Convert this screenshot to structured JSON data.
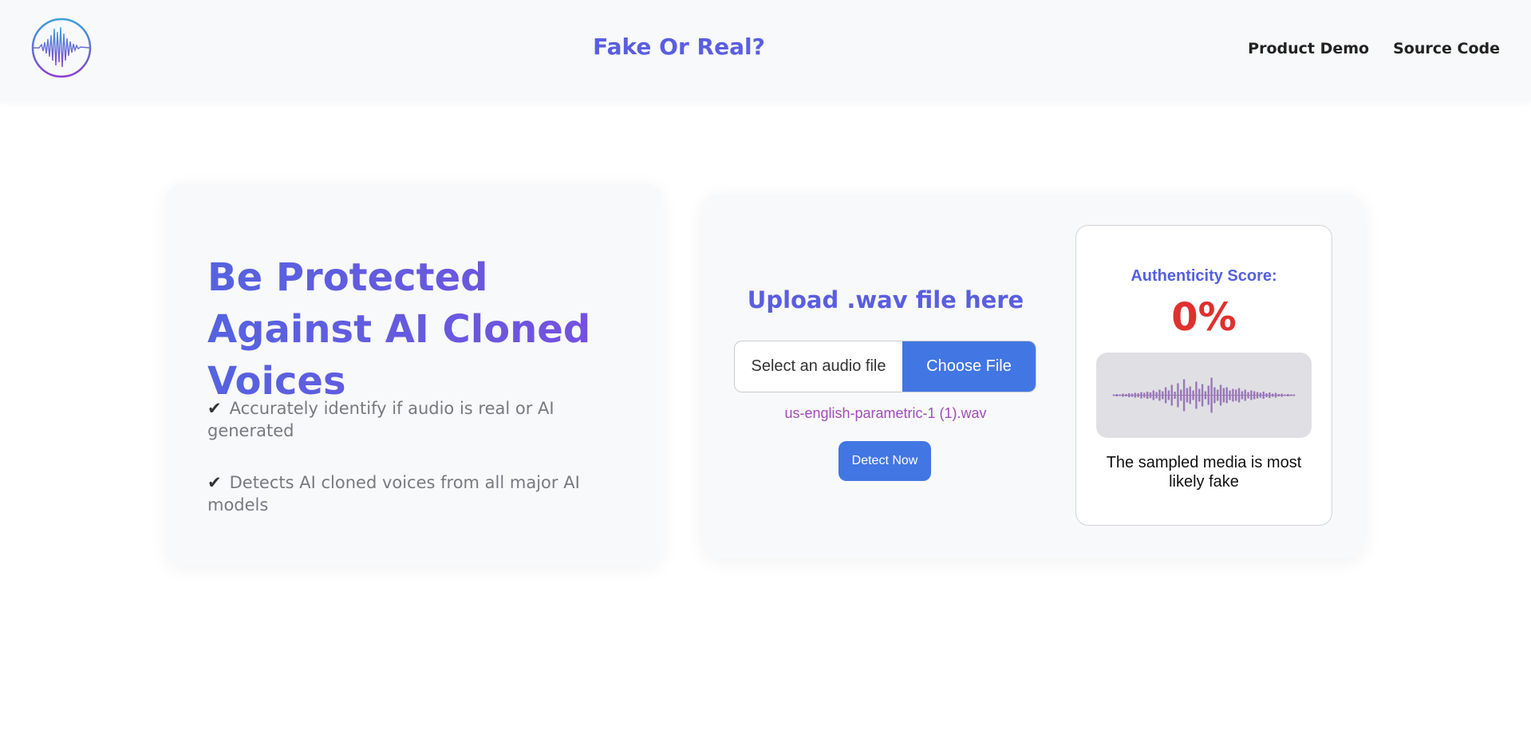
{
  "header": {
    "title": "Fake Or Real?",
    "logo_icon": "waveform-logo-icon",
    "nav": [
      {
        "label": "Product Demo"
      },
      {
        "label": "Source Code"
      }
    ]
  },
  "hero": {
    "title": "Be Protected Against AI Cloned Voices",
    "features": [
      {
        "check": "✔",
        "text": "Accurately identify if audio is real or AI generated"
      },
      {
        "check": "✔",
        "text": "Detects AI cloned voices from all major AI models"
      }
    ]
  },
  "upload": {
    "title": "Upload .wav file here",
    "placeholder": "Select an audio file",
    "choose_label": "Choose File",
    "file_name": "us-english-parametric-1 (1).wav",
    "detect_label": "Detect Now"
  },
  "result": {
    "score_label": "Authenticity Score:",
    "score_value": "0%",
    "waveform_icon": "audio-waveform-icon",
    "verdict": "The sampled media is most likely fake"
  },
  "colors": {
    "accent": "#5a5ee0",
    "button": "#4276e3",
    "score": "#e0302e",
    "file_name": "#a04db8"
  }
}
